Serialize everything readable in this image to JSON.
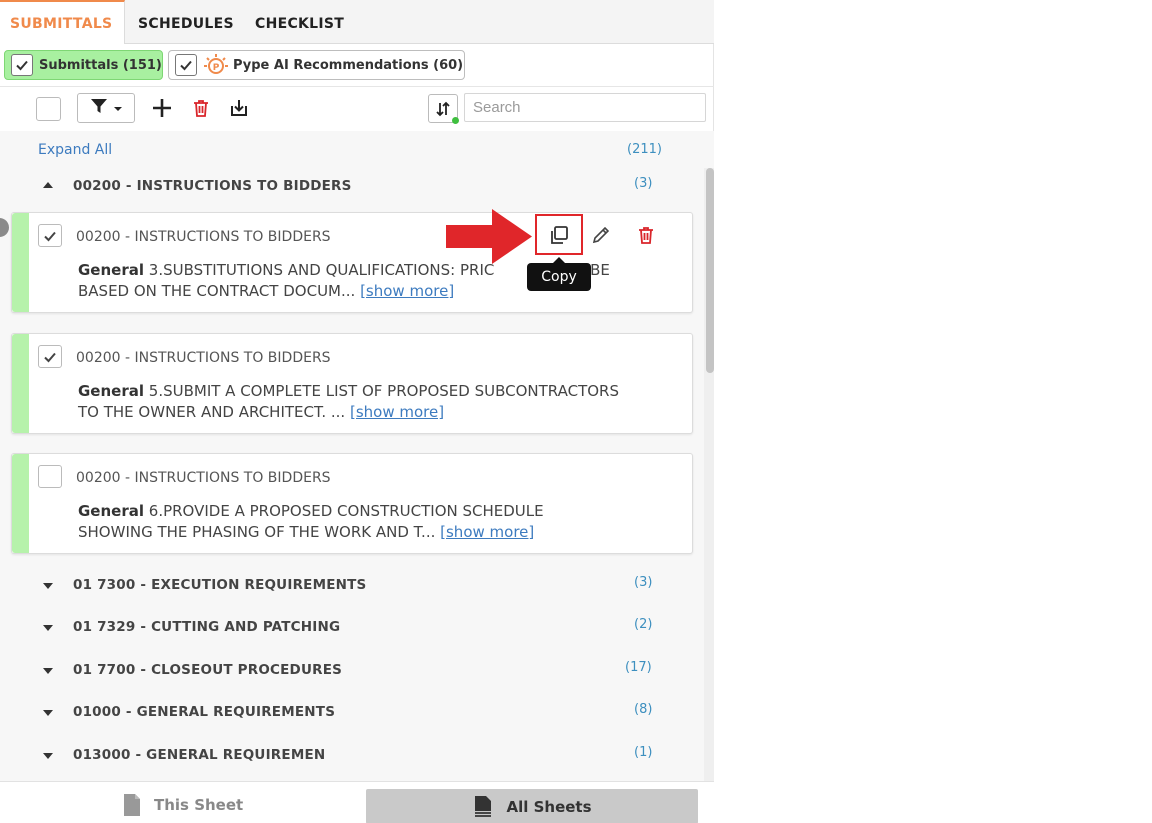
{
  "tabs": [
    {
      "label": "SUBMITTALS",
      "active": true
    },
    {
      "label": "SCHEDULES",
      "active": false
    },
    {
      "label": "CHECKLIST",
      "active": false
    }
  ],
  "chips": {
    "submittals": "Submittals (151)",
    "ai": "Pype AI Recommendations (60)"
  },
  "toolbar": {
    "search_placeholder": "Search"
  },
  "list": {
    "expand_all": "Expand All",
    "total_count": "(211)",
    "open_group": {
      "title": "00200 - INSTRUCTIONS TO BIDDERS",
      "count": "(3)"
    },
    "items": [
      {
        "code": "00200 - INSTRUCTIONS TO BIDDERS",
        "type": "General",
        "text": "3.SUBSTITUTIONS AND QUALIFICATIONS: PRIC",
        "text_tail": "ALL BE",
        "text_line2": "BASED ON THE CONTRACT DOCUM...",
        "show_more": "[show more]",
        "checked": true
      },
      {
        "code": "00200 - INSTRUCTIONS TO BIDDERS",
        "type": "General",
        "text": "5.SUBMIT A COMPLETE LIST OF PROPOSED SUBCONTRACTORS",
        "text_line2": "TO THE OWNER AND ARCHITECT. ...",
        "show_more": "[show more]",
        "checked": true
      },
      {
        "code": "00200 - INSTRUCTIONS TO BIDDERS",
        "type": "General",
        "text": "6.PROVIDE A PROPOSED CONSTRUCTION SCHEDULE",
        "text_line2": "SHOWING THE PHASING OF THE WORK AND T...",
        "show_more": "[show more]",
        "checked": false
      }
    ],
    "groups": [
      {
        "title": "01 7300 - EXECUTION REQUIREMENTS",
        "count": "(3)"
      },
      {
        "title": "01 7329 - CUTTING AND PATCHING",
        "count": "(2)"
      },
      {
        "title": "01 7700 - CLOSEOUT PROCEDURES",
        "count": "(17)"
      },
      {
        "title": "01000 - GENERAL REQUIREMENTS",
        "count": "(8)"
      },
      {
        "title": "013000 - GENERAL REQUIREMEN",
        "count": "(1)"
      }
    ]
  },
  "tooltip": "Copy",
  "bottom": {
    "this_sheet": "This Sheet",
    "all_sheets": "All Sheets"
  },
  "colors": {
    "accent": "#f08a4b",
    "chip_green": "#a8f0a0",
    "card_bar": "#b6f2ab",
    "link": "#3d7bbf",
    "delete_red": "#d9262b",
    "highlight_red": "#e0262a"
  }
}
